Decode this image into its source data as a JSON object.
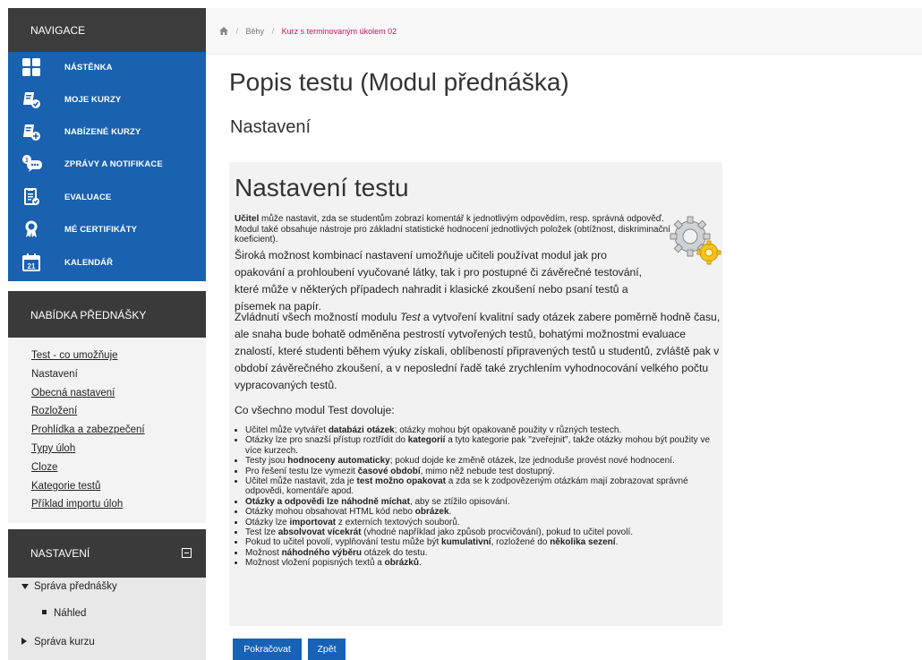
{
  "breadcrumb": {
    "home_icon": "home-icon",
    "items": [
      "Běhy",
      "Kurz s terminovaným úkolem 02"
    ]
  },
  "nav": {
    "title": "NAVIGACE",
    "items": [
      {
        "label": "NÁSTĚNKA",
        "icon": "dashboard-icon"
      },
      {
        "label": "MOJE KURZY",
        "icon": "my-courses-icon"
      },
      {
        "label": "NABÍZENÉ KURZY",
        "icon": "offered-courses-icon"
      },
      {
        "label": "ZPRÁVY A NOTIFIKACE",
        "icon": "messages-icon"
      },
      {
        "label": "EVALUACE",
        "icon": "evaluation-icon"
      },
      {
        "label": "MÉ CERTIFIKÁTY",
        "icon": "certificate-icon"
      },
      {
        "label": "KALENDÁŘ",
        "icon": "calendar-icon",
        "day": "21"
      }
    ]
  },
  "lecture": {
    "title": "NABÍDKA PŘEDNÁŠKY",
    "links": [
      "Test - co umožňuje",
      "Nastavení",
      "Obecná nastavení",
      "Rozložení",
      "Prohlídka a zabezpečení",
      "Typy úloh",
      "Cloze",
      "Kategorie testů",
      "Příklad importu úloh"
    ]
  },
  "settings": {
    "title": "NASTAVENÍ",
    "tree": [
      "Správa přednášky",
      "Náhled",
      "Správa kurzu"
    ]
  },
  "page": {
    "title": "Popis testu (Modul přednáška)",
    "subtitle": "Nastavení",
    "panel_title": "Nastavení testu",
    "intro_bold": "Učitel",
    "intro_rest": " může nastavit, zda se studentům zobrazí komentář k jednotlivým odpovědím, resp. správná odpověď. Modul také obsahuje nástroje pro základní statistické hodnocení jednotlivých položek (obtížnost, diskriminační koeficient).",
    "para1": "Široká možnost kombinací nastavení umožňuje učiteli používat modul jak pro opakování a prohloubení vyučované látky, tak i pro postupné či závěrečné testování, které může v některých případech nahradit i klasické zkoušení nebo psaní testů a písemek na papír.",
    "para2_a": "Zvládnutí všech možností modulu ",
    "para2_em": "Test",
    "para2_b": " a vytvoření kvalitní sady otázek zabere poměrně hodně času, ale snaha bude bohatě odměněna pestrostí vytvořených testů, bohatými možnostmi evaluace znalostí, které studenti během výuky získali, oblíbeností připravených testů u studentů, zvláště pak v období závěrečného zkoušení, a v neposlední řadě také zrychlením vyhodnocování velkého počtu vypracovaných testů.",
    "list_heading": "Co všechno modul Test dovoluje:",
    "bullets": [
      [
        "Učitel může vytvářet ",
        "databázi otázek",
        "; otázky mohou být opakovaně použity v různých testech."
      ],
      [
        "Otázky lze pro snazší přístup roztřídit do ",
        "kategorií",
        " a tyto kategorie pak \"zveřejnit\", takže otázky mohou být použity ve více kurzech."
      ],
      [
        "Testy jsou ",
        "hodnoceny automaticky",
        "; pokud dojde ke změně otázek, lze jednoduše provést nové hodnocení."
      ],
      [
        "Pro řešení testu lze vymezit ",
        "časové období",
        ", mimo něž nebude test dostupný."
      ],
      [
        "Učitel může nastavit, zda je ",
        "test možno opakovat",
        " a zda se k zodpovězeným otázkám mají zobrazovat správné odpovědi, komentáře apod."
      ],
      [
        "",
        "Otázky a odpovědi lze náhodně míchat",
        ", aby se ztížilo opisování."
      ],
      [
        "Otázky mohou obsahovat HTML kód nebo ",
        "obrázek",
        "."
      ],
      [
        "Otázky lze ",
        "importovat",
        " z externích textových souborů."
      ],
      [
        "Test lze ",
        "absolvovat vícekrát",
        " (vhodné například jako způsob procvičování), pokud to učitel povolí."
      ],
      [
        "Pokud to učitel povolí, vyplňování testu může být ",
        "kumulativní",
        ", rozložené do "
      ],
      [
        "Možnost ",
        "náhodného výběru",
        " otázek do testu."
      ],
      [
        "Možnost vložení popisných textů a ",
        "obrázků",
        "."
      ]
    ],
    "bullet10_tail_bold": "několika sezení",
    "bullet10_tail": ".",
    "buttons": {
      "continue": "Pokračovat",
      "back": "Zpět"
    },
    "illustration": "gears-icon"
  }
}
